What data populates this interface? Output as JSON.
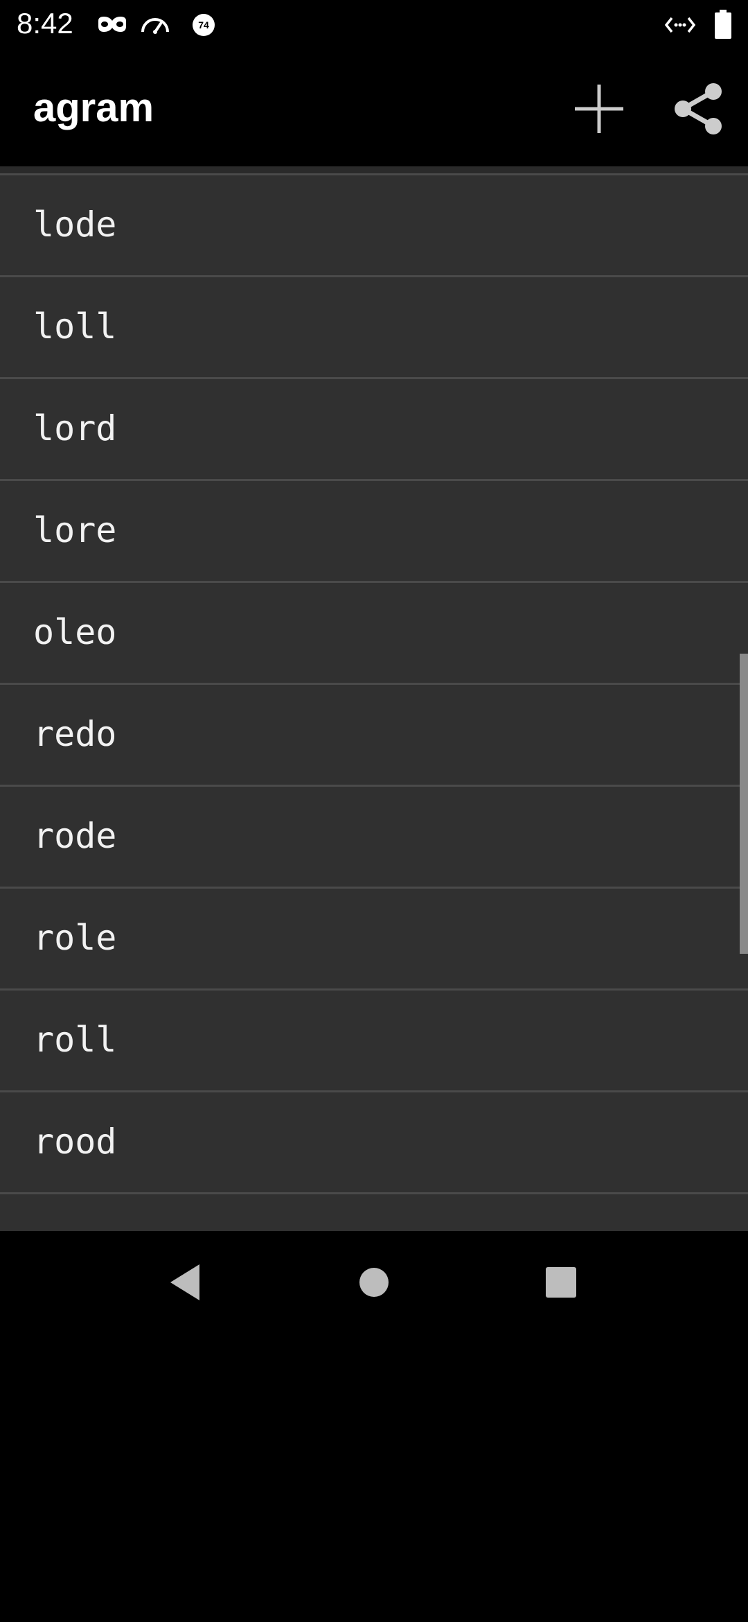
{
  "status_bar": {
    "time": "8:42",
    "icons": [
      "incognito-mask-icon",
      "speed-gauge-icon",
      "badge-74-icon",
      "code-arrows-icon",
      "battery-icon"
    ],
    "badge_text": "74"
  },
  "app_bar": {
    "title": "agram",
    "actions": [
      "add-icon",
      "share-icon"
    ]
  },
  "list": {
    "items": [
      "lode",
      "loll",
      "lord",
      "lore",
      "oleo",
      "redo",
      "rode",
      "role",
      "roll",
      "rood"
    ]
  },
  "nav_bar": {
    "buttons": [
      "back-icon",
      "home-icon",
      "recents-icon"
    ]
  },
  "colors": {
    "background": "#000000",
    "list_background": "#303030",
    "divider": "#4a4a4a",
    "text": "#f2f2f2",
    "icon": "#cccccc"
  }
}
